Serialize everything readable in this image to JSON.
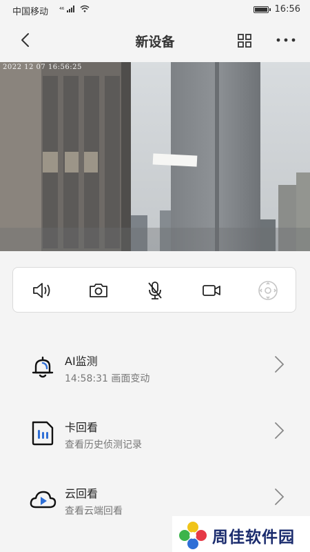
{
  "status_bar": {
    "carrier": "中国移动",
    "signal": "⁴⁶",
    "time": "16:56"
  },
  "nav": {
    "title": "新设备"
  },
  "video": {
    "timestamp": "2022 12 07 16:56:25"
  },
  "controls": [
    {
      "name": "speaker-icon"
    },
    {
      "name": "camera-icon"
    },
    {
      "name": "mic-off-icon"
    },
    {
      "name": "video-record-icon"
    },
    {
      "name": "ptz-icon"
    }
  ],
  "menu": [
    {
      "label": "AI监测",
      "sub": "14:58:31  画面变动",
      "icon": "bell-icon"
    },
    {
      "label": "卡回看",
      "sub": "查看历史侦测记录",
      "icon": "sd-card-icon"
    },
    {
      "label": "云回看",
      "sub": "查看云端回看",
      "icon": "cloud-play-icon"
    }
  ],
  "watermark": {
    "text": "周佳软件园"
  },
  "colors": {
    "accent_blue": "#2f6fd6",
    "background": "#f4f4f4"
  }
}
